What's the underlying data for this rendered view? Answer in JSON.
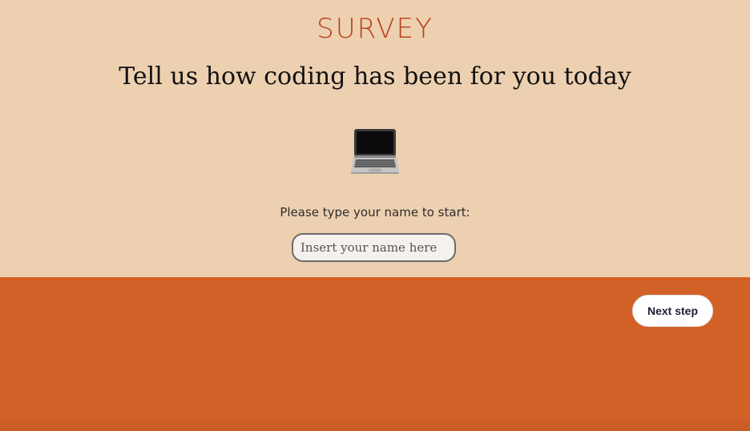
{
  "header": {
    "title": "SURVEY",
    "headline": "Tell us how coding has been for you today",
    "icon": "laptop-icon"
  },
  "form": {
    "prompt": "Please type your name to start:",
    "name_value": "",
    "name_placeholder": "Insert your name here"
  },
  "footer": {
    "next_label": "Next step"
  },
  "colors": {
    "top_background": "#edd0b0",
    "bottom_background": "#d26128",
    "title_accent": "#b6401a"
  }
}
